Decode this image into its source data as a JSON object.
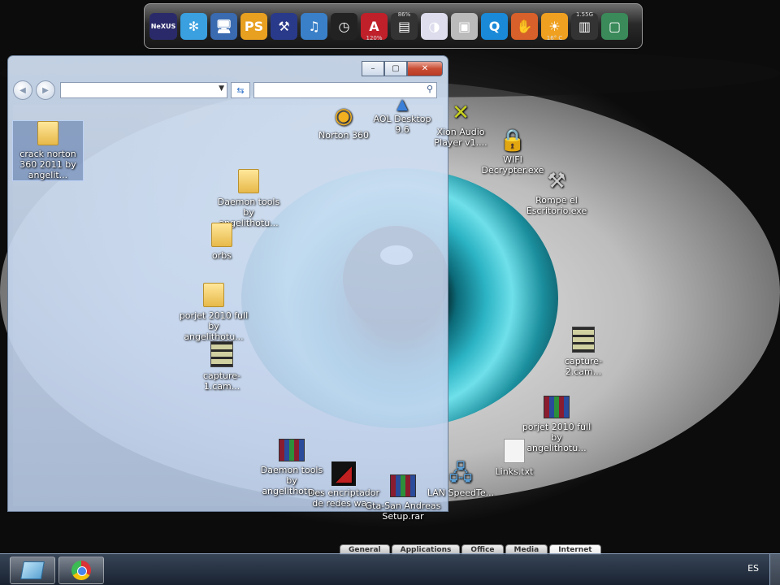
{
  "dock": {
    "items": [
      {
        "name": "nexus-logo-icon",
        "glyph": "NeXUS",
        "color": "#2a2a6a"
      },
      {
        "name": "pinwheel-icon",
        "glyph": "✻",
        "color": "#3aa0e0"
      },
      {
        "name": "monitor-icon",
        "glyph": "🖥",
        "color": "#3a6ab0"
      },
      {
        "name": "playstation-icon",
        "glyph": "PS",
        "color": "#e8a020"
      },
      {
        "name": "tools-icon",
        "glyph": "⚒",
        "color": "#2a3a8a"
      },
      {
        "name": "itunes-icon",
        "glyph": "♫",
        "color": "#3a80c8"
      },
      {
        "name": "clock-icon",
        "glyph": "◷",
        "color": "#222"
      },
      {
        "name": "adobe-icon",
        "glyph": "A",
        "color": "#c0202a",
        "sub": "120%"
      },
      {
        "name": "cpu-meter-icon",
        "glyph": "▤",
        "color": "#333",
        "top": "86%"
      },
      {
        "name": "speed-gauge-icon",
        "glyph": "◑",
        "color": "#dde"
      },
      {
        "name": "camera-icon",
        "glyph": "▣",
        "color": "#bbb"
      },
      {
        "name": "quicktime-icon",
        "glyph": "Q",
        "color": "#1a8ad8"
      },
      {
        "name": "hand-icon",
        "glyph": "✋",
        "color": "#d8602a"
      },
      {
        "name": "weather-sun-icon",
        "glyph": "☀",
        "color": "#f0a020",
        "sub": "16° C"
      },
      {
        "name": "memory-meter-icon",
        "glyph": "▥",
        "color": "#333",
        "top": "1.55G"
      },
      {
        "name": "screen-capture-icon",
        "glyph": "▢",
        "color": "#3a8a5a"
      }
    ]
  },
  "explorer": {
    "address_value": "",
    "search_placeholder": "",
    "minimize": "–",
    "maximize": "▢",
    "close": "✕"
  },
  "desktop_icons": [
    {
      "id": "crack-norton",
      "label": "crack norton 360 2011 by angelit...",
      "type": "folder"
    },
    {
      "id": "norton-360",
      "label": "Norton 360",
      "type": "app"
    },
    {
      "id": "aol-desktop",
      "label": "AOL Desktop 9.6",
      "type": "app"
    },
    {
      "id": "xion-audio",
      "label": "Xion Audio Player v1....",
      "type": "app"
    },
    {
      "id": "wifi-decrypter",
      "label": "WIFI Decrypter.exe",
      "type": "app"
    },
    {
      "id": "daemon-folder",
      "label": "Daemon tools by angelithotu...",
      "type": "folder"
    },
    {
      "id": "rompe-escritorio",
      "label": "Rompe el Escritorio.exe",
      "type": "app"
    },
    {
      "id": "orbs",
      "label": "orbs",
      "type": "folder"
    },
    {
      "id": "porjet-folder",
      "label": "porjet 2010 full by angelithotu...",
      "type": "folder"
    },
    {
      "id": "capture-1",
      "label": "capture-1.cam...",
      "type": "film"
    },
    {
      "id": "capture-2",
      "label": "capture-2.cam...",
      "type": "film"
    },
    {
      "id": "porjet-rar",
      "label": "porjet 2010 full by angelithotu...",
      "type": "rar"
    },
    {
      "id": "daemon-rar",
      "label": "Daemon tools by angelithotu...",
      "type": "rar"
    },
    {
      "id": "links",
      "label": "Links.txt",
      "type": "doc"
    },
    {
      "id": "des-encriptador",
      "label": "Des encriptador de redes wa...",
      "type": "app"
    },
    {
      "id": "gta-setup",
      "label": "Gta-San Andreas Setup.rar",
      "type": "rar"
    },
    {
      "id": "lan-speed",
      "label": "LAN SpeedTe...",
      "type": "app"
    }
  ],
  "bottom_tabs": [
    "General",
    "Applications",
    "Office",
    "Media",
    "Internet"
  ],
  "taskbar": {
    "language": "ES"
  }
}
